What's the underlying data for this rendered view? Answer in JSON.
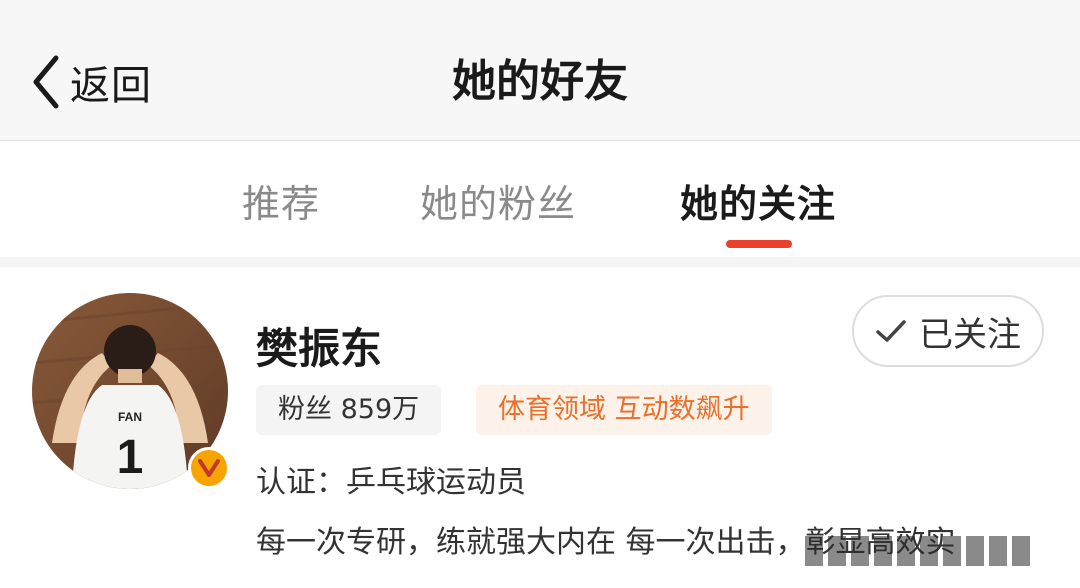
{
  "header": {
    "back_label": "返回",
    "title": "她的好友",
    "back_icon": "chevron-left-icon"
  },
  "tabs": [
    {
      "label": "推荐",
      "active": false
    },
    {
      "label": "她的粉丝",
      "active": false
    },
    {
      "label": "她的关注",
      "active": true
    }
  ],
  "colors": {
    "accent": "#e8422c",
    "verified_badge": "#f7a400",
    "hot_tag_text": "#e8702a",
    "hot_tag_bg": "#fdf2ea"
  },
  "user": {
    "name": "樊振东",
    "follow_label": "已关注",
    "follow_icon": "check-icon",
    "verified_icon": "verified-v-icon",
    "fans_tag": "粉丝 859万",
    "hot_tag": "体育领域 互动数飙升",
    "verification": "认证：乒乓球运动员",
    "bio": "每一次专研，练就强大内在 每一次出击，彰显高效实",
    "avatar": {
      "jersey_name": "FAN",
      "jersey_number": "1"
    }
  }
}
